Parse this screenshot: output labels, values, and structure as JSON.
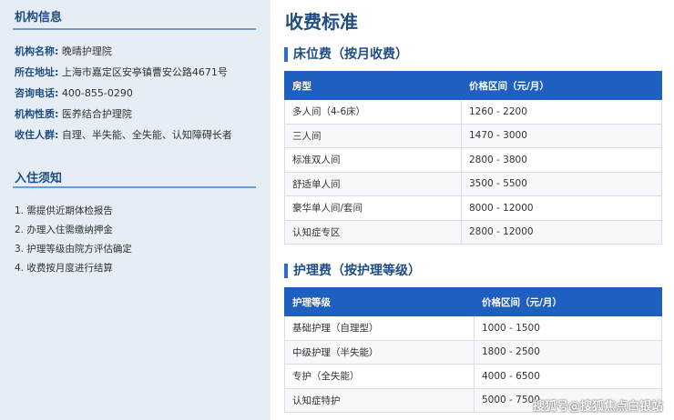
{
  "sidebar": {
    "org_title": "机构信息",
    "info": [
      {
        "key": "机构名称:",
        "value": "晚晴护理院"
      },
      {
        "key": "所在地址:",
        "value": "上海市嘉定区安亭镇曹安公路4671号"
      },
      {
        "key": "咨询电话:",
        "value": "400-855-0290"
      },
      {
        "key": "机构性质:",
        "value": "医养结合护理院"
      },
      {
        "key": "收住人群:",
        "value": "自理、半失能、全失能、认知障碍长者"
      }
    ],
    "admission_title": "入住须知",
    "steps": [
      "1. 需提供近期体检报告",
      "2. 办理入住需缴纳押金",
      "3. 护理等级由院方评估确定",
      "4. 收费按月度进行结算"
    ]
  },
  "main": {
    "title": "收费标准",
    "bed": {
      "heading": "床位费（按月收费）",
      "columns": [
        "房型",
        "价格区间（元/月）"
      ],
      "rows": [
        [
          "多人间（4-6床）",
          "1260 - 2200"
        ],
        [
          "三人间",
          "1470 - 3000"
        ],
        [
          "标准双人间",
          "2800 - 3800"
        ],
        [
          "舒适单人间",
          "3500 - 5500"
        ],
        [
          "豪华单人间/套间",
          "8000 - 12000"
        ],
        [
          "认知症专区",
          "2800 - 12000"
        ]
      ]
    },
    "care": {
      "heading": "护理费（按护理等级）",
      "columns": [
        "护理等级",
        "价格区间（元/月）"
      ],
      "rows": [
        [
          "基础护理（自理型）",
          "1000 - 1500"
        ],
        [
          "中级护理（半失能）",
          "1800 - 2500"
        ],
        [
          "专护（全失能）",
          "4000 - 6500"
        ],
        [
          "认知症特护",
          "5000 - 7500"
        ]
      ]
    }
  },
  "watermark": "搜狐号@搜狐焦点白银站",
  "colors": {
    "accent": "#1e5fbf",
    "heading": "#1f4d82",
    "sidebar_bg": "#e6edf5"
  }
}
